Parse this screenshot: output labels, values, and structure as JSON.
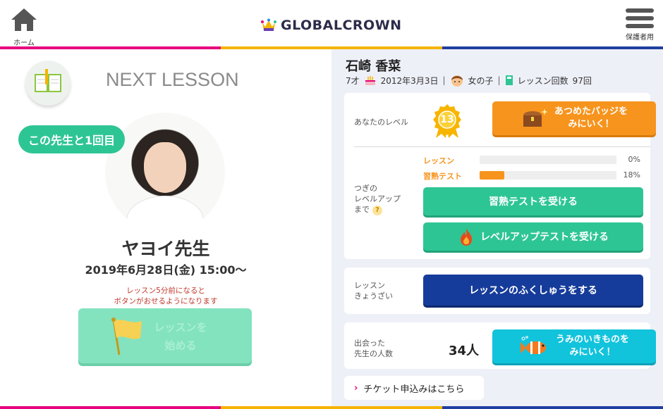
{
  "header": {
    "home_label": "ホーム",
    "logo_text": "GLOBALCROWN",
    "guardian_label": "保護者用"
  },
  "left": {
    "next_lesson_label": "NEXT LESSON",
    "first_badge": "この先生と1回目",
    "teacher_name": "ヤヨイ先生",
    "lesson_datetime": "2019年6月28日(金) 15:00〜",
    "notice_line1": "レッスン5分前になると",
    "notice_line2": "ボタンがおせるようになります",
    "start_button_line1": "レッスンを",
    "start_button_line2": "始める"
  },
  "student": {
    "name": "石崎 香菜",
    "age": "7才",
    "birthday": "2012年3月3日",
    "gender": "女の子",
    "lesson_count_label": "レッスン回数",
    "lesson_count": "97回"
  },
  "level": {
    "label": "あなたのレベル",
    "value": "13",
    "badges_button_line1": "あつめたバッジを",
    "badges_button_line2": "みにいく！"
  },
  "levelup": {
    "label_line1": "つぎの",
    "label_line2": "レベルアップ",
    "label_line3": "まで",
    "help": "?",
    "progress": [
      {
        "label": "レッスン",
        "percent_text": "0%",
        "fraction": 0.0
      },
      {
        "label": "習熟テスト",
        "percent_text": "18%",
        "fraction": 0.18
      }
    ],
    "proficiency_test_button": "習熟テストを受ける",
    "levelup_test_button": "レベルアップテストを受ける"
  },
  "review": {
    "label_line1": "レッスン",
    "label_line2": "きょうざい",
    "button": "レッスンのふくしゅうをする"
  },
  "met": {
    "label_line1": "出会った",
    "label_line2": "先生の人数",
    "count": "34人",
    "button_line1": "うみのいきものを",
    "button_line2": "みにいく！"
  },
  "ticket": {
    "chevron": "›",
    "label": "チケット申込みはこちら"
  },
  "colors": {
    "accent_green": "#2ec594",
    "accent_orange": "#f7941d",
    "accent_navy": "#163c9b",
    "accent_cyan": "#12c3dc",
    "stripe_pink": "#e6007e",
    "stripe_yellow": "#f5b400",
    "stripe_blue": "#1f3fa0"
  }
}
